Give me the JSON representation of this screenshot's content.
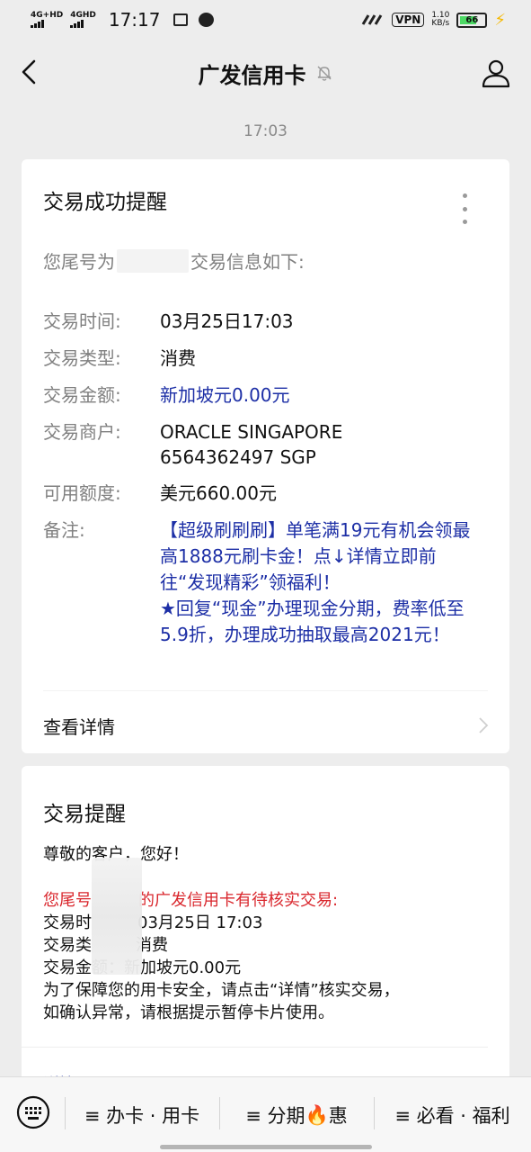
{
  "status_bar": {
    "network1": "4G+HD",
    "network2": "4GHD",
    "time": "17:17",
    "vpn": "VPN",
    "speed_value": "1.10",
    "speed_unit": "KB/s",
    "battery": "66"
  },
  "nav": {
    "title": "广发信用卡"
  },
  "timestamp": "17:03",
  "card1": {
    "title": "交易成功提醒",
    "intro_prefix": "您尾号为",
    "intro_suffix": "交易信息如下:",
    "rows": [
      {
        "label": "交易时间:",
        "value": "03月25日17:03"
      },
      {
        "label": "交易类型:",
        "value": "消费"
      },
      {
        "label": "交易金额:",
        "value": "新加坡元0.00元"
      },
      {
        "label": "交易商户:",
        "value": "ORACLE  SINGAPORE\n6564362497    SGP"
      },
      {
        "label": "可用额度:",
        "value": "美元660.00元"
      },
      {
        "label": "备注:",
        "value": "【超级刷刷刷】单笔满19元有机会领最高1888元刷卡金！点↓详情立即前往“发现精彩”领福利！\n★回复“现金”办理现金分期，费率低至5.9折，办理成功抽取最高2021元！"
      }
    ],
    "details_label": "查看详情"
  },
  "card2": {
    "title": "交易提醒",
    "greeting": "尊敬的客户，您好！",
    "alert_prefix": "您尾号",
    "alert_suffix": "的广发信用卡有待核实交易:",
    "time_label": "交易时",
    "time_value": "03月25日 17:03",
    "type_label": "交易类",
    "type_value": "消费",
    "amount_line": "交易金额：新加坡元0.00元",
    "note1": "为了保障您的用卡安全，请点击“详情”核实交易，",
    "note2": "如确认异常，请根据提示暂停卡片使用。",
    "more_label": "详情"
  },
  "bottom_menu": {
    "item1": "≡ 办卡 · 用卡",
    "item2_prefix": "≡ 分期",
    "item2_emoji": "🔥",
    "item2_suffix": "惠",
    "item3": "≡ 必看 · 福利"
  },
  "colors": {
    "blue_text": "#1d2fa6",
    "red_text": "#d9262c",
    "background": "#ededed"
  }
}
